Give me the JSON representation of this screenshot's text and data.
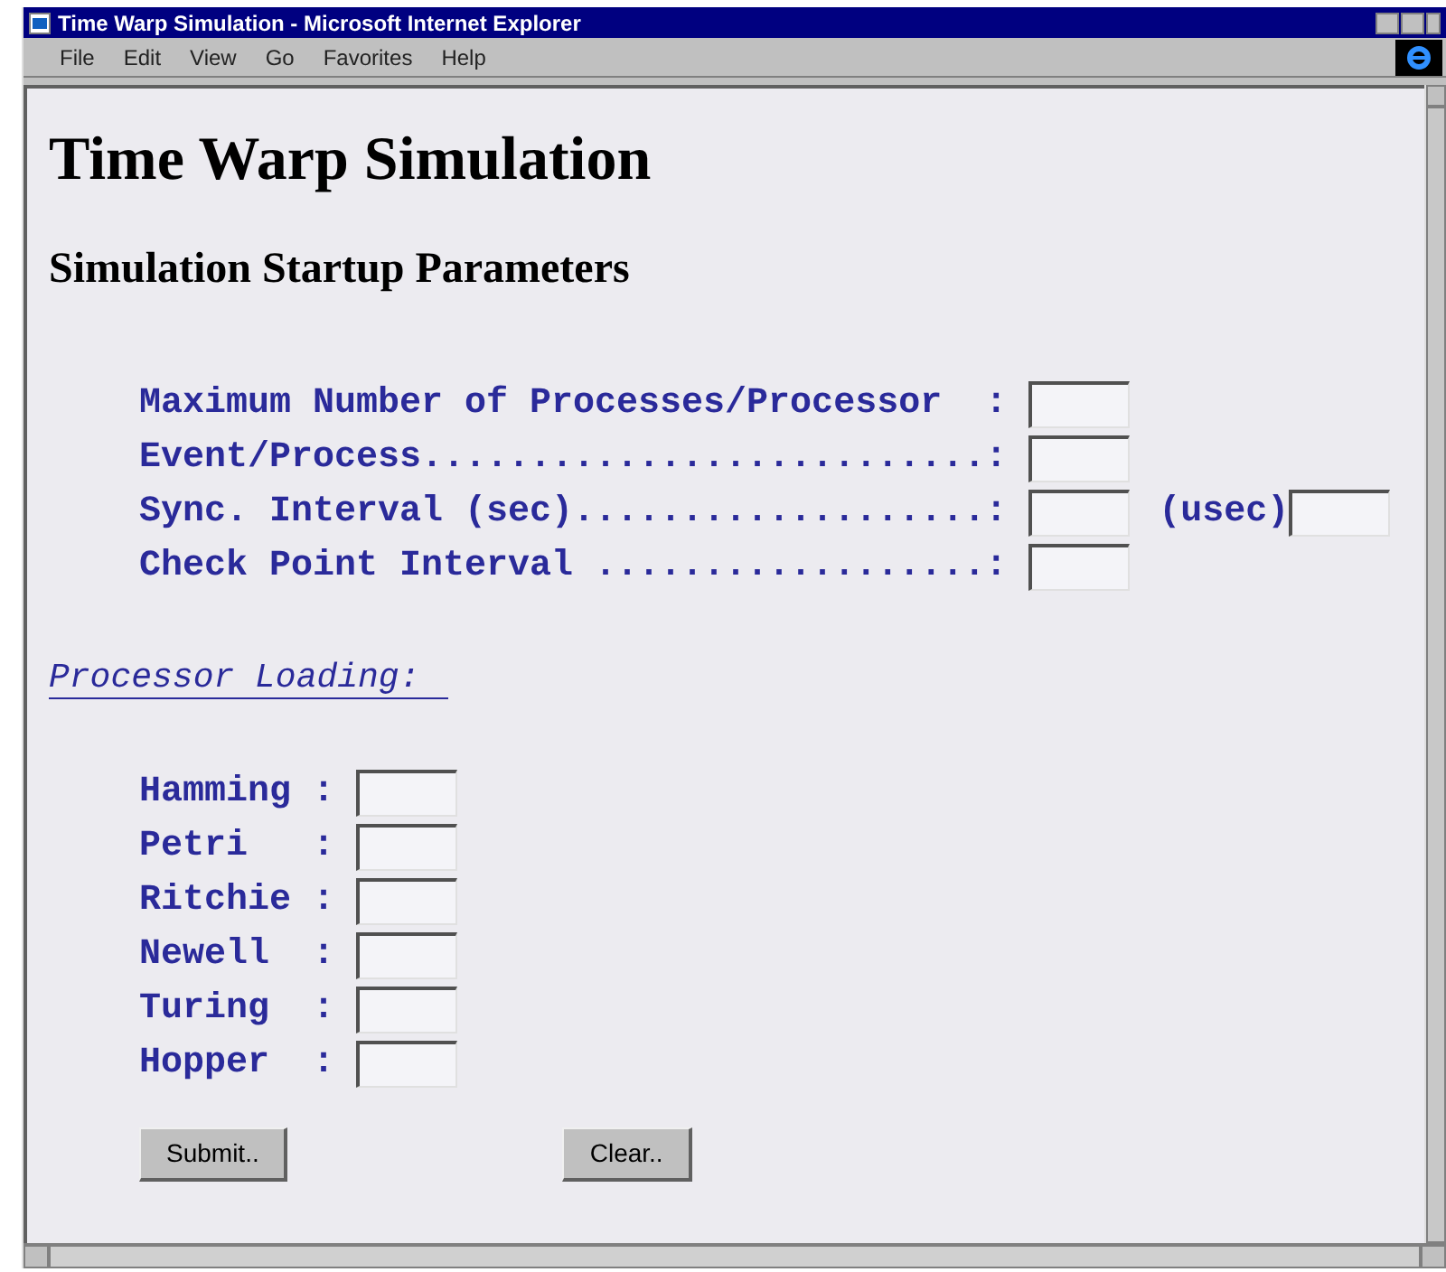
{
  "window": {
    "title": "Time Warp Simulation - Microsoft Internet Explorer"
  },
  "menu": [
    "File",
    "Edit",
    "View",
    "Go",
    "Favorites",
    "Help"
  ],
  "page": {
    "title": "Time Warp Simulation",
    "subtitle": "Simulation Startup Parameters",
    "parameters": [
      {
        "label": "Maximum Number of Processes/Processor  : "
      },
      {
        "label": "Event/Process..........................: "
      },
      {
        "label": "Sync. Interval (sec)...................: ",
        "extra_label": "(usec)"
      },
      {
        "label": "Check Point Interval ..................: "
      }
    ],
    "loading_heading": "Processor Loading:",
    "processors": [
      {
        "label": "Hamming : "
      },
      {
        "label": "Petri   : "
      },
      {
        "label": "Ritchie : "
      },
      {
        "label": "Newell  : "
      },
      {
        "label": "Turing  : "
      },
      {
        "label": "Hopper  : "
      }
    ],
    "buttons": [
      "Submit..",
      "Clear.."
    ]
  }
}
